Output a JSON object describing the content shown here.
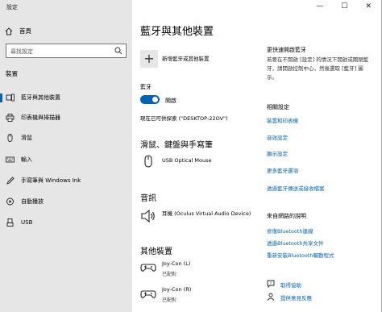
{
  "window": {
    "title": "設定",
    "minimize": "—",
    "maximize": "☐",
    "close": "✕"
  },
  "sidebar": {
    "home": "首頁",
    "search_placeholder": "尋找設定",
    "section": "裝置",
    "items": [
      {
        "label": "藍牙與其他裝置",
        "icon": "bluetooth-icon"
      },
      {
        "label": "印表機與掃描器",
        "icon": "printer-icon"
      },
      {
        "label": "滑鼠",
        "icon": "mouse-icon"
      },
      {
        "label": "輸入",
        "icon": "keyboard-icon"
      },
      {
        "label": "手寫筆與 Windows Ink",
        "icon": "pen-icon"
      },
      {
        "label": "自動播放",
        "icon": "autoplay-icon"
      },
      {
        "label": "USB",
        "icon": "usb-icon"
      }
    ]
  },
  "main": {
    "title": "藍牙與其他裝置",
    "add_device": "新增藍牙或其他裝置",
    "bluetooth_label": "藍牙",
    "bluetooth_state": "開啟",
    "discoverable": "現在已可供探索 (\"DESKTOP-22OV\")",
    "section_mouse": "滑鼠、鍵盤與手寫筆",
    "mouse_device": "USB Optical Mouse",
    "section_audio": "音訊",
    "audio_device": "耳機 (Oculus Virtual Audio Device)",
    "section_other": "其他裝置",
    "other_devices": [
      {
        "name": "Joy-Con (L)",
        "status": "已配對"
      },
      {
        "name": "Joy-Con (R)",
        "status": "已配對"
      }
    ]
  },
  "right": {
    "faster_title": "更快速開啟藍牙",
    "faster_text": "若要在不開啟 [設定] 的情況下開啟或關閉藍牙，請開啟控制中心，然後選取 [藍牙] 圖示。",
    "related_title": "相關設定",
    "related_links": [
      "裝置和印表機",
      "音效設定",
      "顯示設定",
      "更多藍牙選項",
      "透過藍牙傳送或接收檔案"
    ],
    "web_title": "來自網路的說明",
    "web_links": [
      "修復Bluetooth連線",
      "透過Bluetooth共享文件",
      "重新安裝Bluetooth驅動程式"
    ],
    "get_help": "取得協助",
    "feedback": "提供意見反應"
  }
}
